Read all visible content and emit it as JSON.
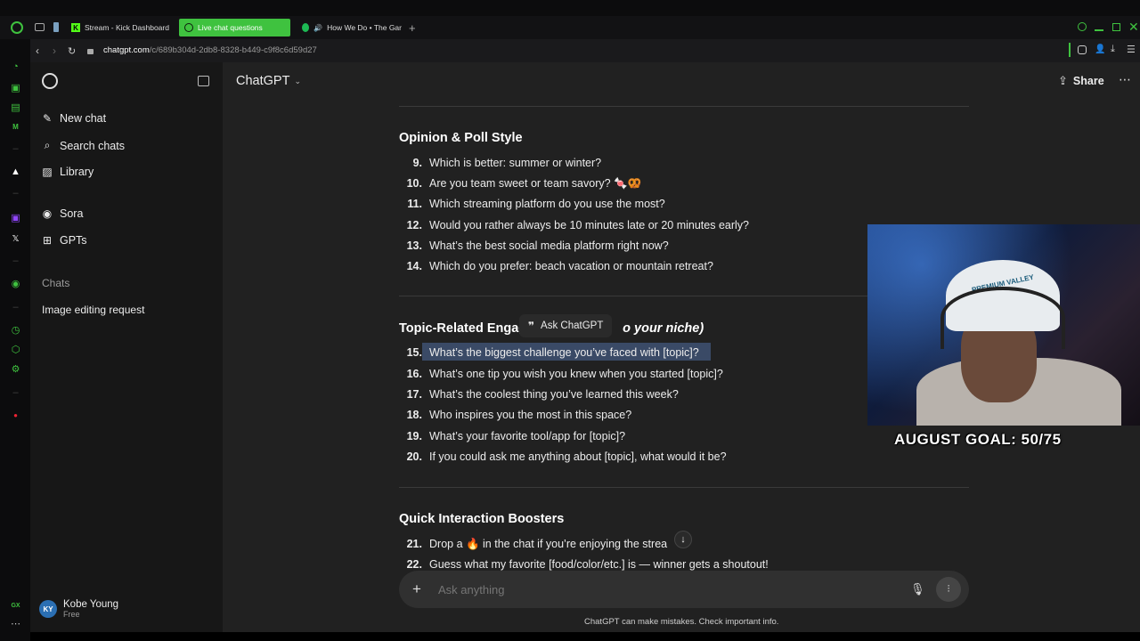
{
  "browser": {
    "tabs": [
      {
        "label": "Stream - Kick Dashboard",
        "icon": "kick-icon"
      },
      {
        "label": "Live chat questions",
        "icon": "chatgpt-icon"
      },
      {
        "label": "How We Do • The Gar",
        "icon": "spotify-icon"
      }
    ],
    "url_host": "chatgpt.com",
    "url_path": "/c/689b304d-2db8-8328-b449-c9f8c6d59d27"
  },
  "sidebar": {
    "items": [
      {
        "label": "New chat",
        "icon": "new-chat-icon"
      },
      {
        "label": "Search chats",
        "icon": "search-icon"
      },
      {
        "label": "Library",
        "icon": "library-icon"
      },
      {
        "label": "Sora",
        "icon": "sora-icon"
      },
      {
        "label": "GPTs",
        "icon": "gpts-icon"
      }
    ],
    "section_label": "Chats",
    "chats": [
      "Image editing request"
    ],
    "user": {
      "initials": "KY",
      "name": "Kobe Young",
      "plan": "Free"
    }
  },
  "header": {
    "title": "ChatGPT",
    "share_label": "Share"
  },
  "content": {
    "sections": [
      {
        "title": "Opinion & Poll Style",
        "items": [
          {
            "num": "9.",
            "text": "Which is better: summer or winter?"
          },
          {
            "num": "10.",
            "text": "Are you team sweet or team savory? 🍬🥨"
          },
          {
            "num": "11.",
            "text": "Which streaming platform do you use the most?"
          },
          {
            "num": "12.",
            "text": "Would you rather always be 10 minutes late or 20 minutes early?"
          },
          {
            "num": "13.",
            "text": "What’s the best social media platform right now?"
          },
          {
            "num": "14.",
            "text": "Which do you prefer: beach vacation or mountain retreat?"
          }
        ]
      },
      {
        "title_start": "Topic-Related Engag",
        "title_end": "o your niche)",
        "items": [
          {
            "num": "15.",
            "text": "What’s the biggest challenge you’ve faced with [topic]?"
          },
          {
            "num": "16.",
            "text": "What’s one tip you wish you knew when you started [topic]?"
          },
          {
            "num": "17.",
            "text": "What’s the coolest thing you’ve learned this week?"
          },
          {
            "num": "18.",
            "text": "Who inspires you the most in this space?"
          },
          {
            "num": "19.",
            "text": "What’s your favorite tool/app for [topic]?"
          },
          {
            "num": "20.",
            "text": "If you could ask me anything about [topic], what would it be?"
          }
        ]
      },
      {
        "title": "Quick Interaction Boosters",
        "items": [
          {
            "num": "21.",
            "text": "Drop a 🔥 in the chat if you’re enjoying the strea"
          },
          {
            "num": "22.",
            "text": "Guess what my favorite [food/color/etc.] is — winner gets a shoutout!"
          }
        ]
      }
    ],
    "ask_tooltip": "Ask ChatGPT"
  },
  "composer": {
    "placeholder": "Ask anything"
  },
  "disclaimer": "ChatGPT can make mistakes. Check important info.",
  "overlay": {
    "goal_text": "AUGUST GOAL: 50/75",
    "cap_text": "PREMIUM VALLEY"
  }
}
